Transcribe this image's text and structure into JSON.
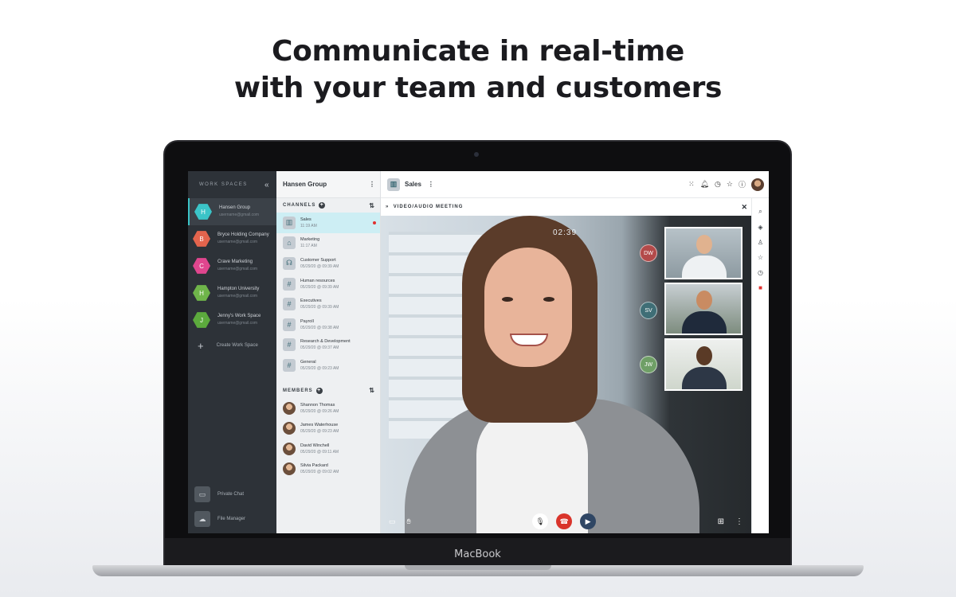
{
  "headline": {
    "line1": "Communicate in real-time",
    "line2": "with your team and customers"
  },
  "device": {
    "brand": "MacBook"
  },
  "workspaces": {
    "title": "WORK SPACES",
    "collapse_icon": "double-chevron-left-icon",
    "items": [
      {
        "initial": "H",
        "name": "Hansen Group",
        "sub": "username@gmail.com",
        "color": "#3bc4c8"
      },
      {
        "initial": "B",
        "name": "Bryce Holding Company",
        "sub": "username@gmail.com",
        "color": "#e3644d"
      },
      {
        "initial": "C",
        "name": "Crave Marketing",
        "sub": "username@gmail.com",
        "color": "#e0468e"
      },
      {
        "initial": "H",
        "name": "Hampton University",
        "sub": "username@gmail.com",
        "color": "#6fb54a"
      },
      {
        "initial": "J",
        "name": "Jenny's Work Space",
        "sub": "username@gmail.com",
        "color": "#5caa3d"
      }
    ],
    "create_label": "Create Work Space",
    "private_chat": "Private Chat",
    "file_manager": "File Manager"
  },
  "channel_panel": {
    "group_name": "Hansen Group",
    "channels_title": "CHANNELS",
    "channels": [
      {
        "name": "Sales",
        "time": "11:19 AM"
      },
      {
        "name": "Marketing",
        "time": "11:17 AM"
      },
      {
        "name": "Customer Support",
        "time": "05/29/20 @ 09:39 AM"
      },
      {
        "name": "Human resources",
        "time": "05/29/20 @ 09:39 AM"
      },
      {
        "name": "Executives",
        "time": "05/29/20 @ 09:39 AM"
      },
      {
        "name": "Payroll",
        "time": "05/29/20 @ 09:38 AM"
      },
      {
        "name": "Research & Development",
        "time": "05/29/20 @ 09:37 AM"
      },
      {
        "name": "General",
        "time": "05/29/20 @ 09:23 AM"
      }
    ],
    "members_title": "MEMBERS",
    "members": [
      {
        "name": "Shannon Thomas",
        "time": "05/29/20 @ 09:26 AM"
      },
      {
        "name": "James Waterhouse",
        "time": "05/29/20 @ 09:23 AM"
      },
      {
        "name": "David Winchell",
        "time": "05/29/20 @ 09:11 AM"
      },
      {
        "name": "Silvia Packard",
        "time": "05/29/20 @ 09:02 AM"
      }
    ]
  },
  "main": {
    "channel": "Sales",
    "meeting_title": "VIDEO/AUDIO MEETING",
    "timer": "02:39",
    "participants": [
      {
        "initials": "DW",
        "color": "#b34a4a"
      },
      {
        "initials": "SV",
        "color": "#3f6e76"
      },
      {
        "initials": "JW",
        "color": "#6f9f66"
      }
    ]
  }
}
